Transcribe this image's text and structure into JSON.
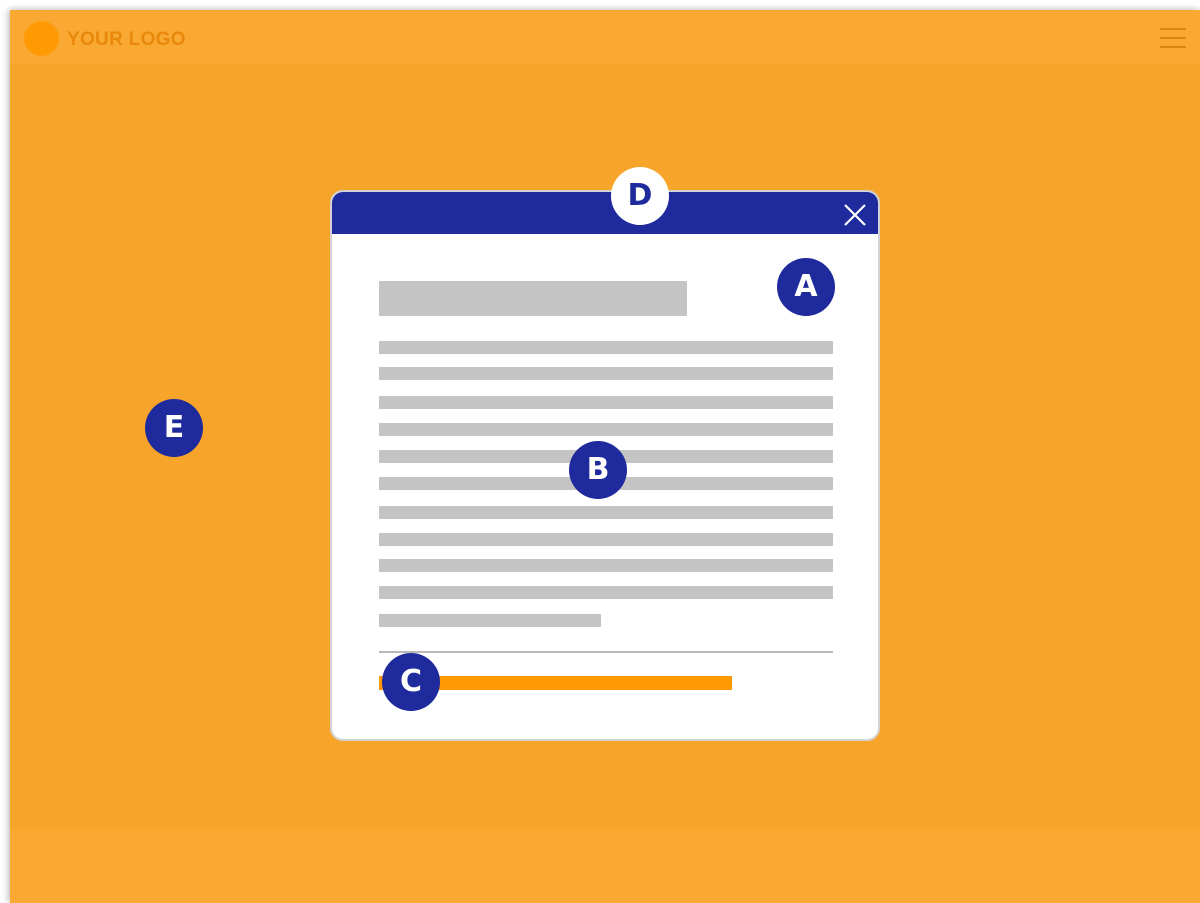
{
  "header": {
    "logo_text": "YOUR LOGO",
    "menu_icon": "hamburger-menu-icon"
  },
  "modal": {
    "close_icon": "close-icon",
    "text_line_count": 11
  },
  "markers": {
    "a": "A",
    "b": "B",
    "c": "C",
    "d": "D",
    "e": "E"
  },
  "colors": {
    "page_background": "#f6a42a",
    "header_footer": "#f9a832",
    "accent_orange": "#ff9a05",
    "modal_header": "#1f2a9c",
    "marker_fill": "#1f2a9c",
    "placeholder_gray": "#c4c4c4"
  }
}
